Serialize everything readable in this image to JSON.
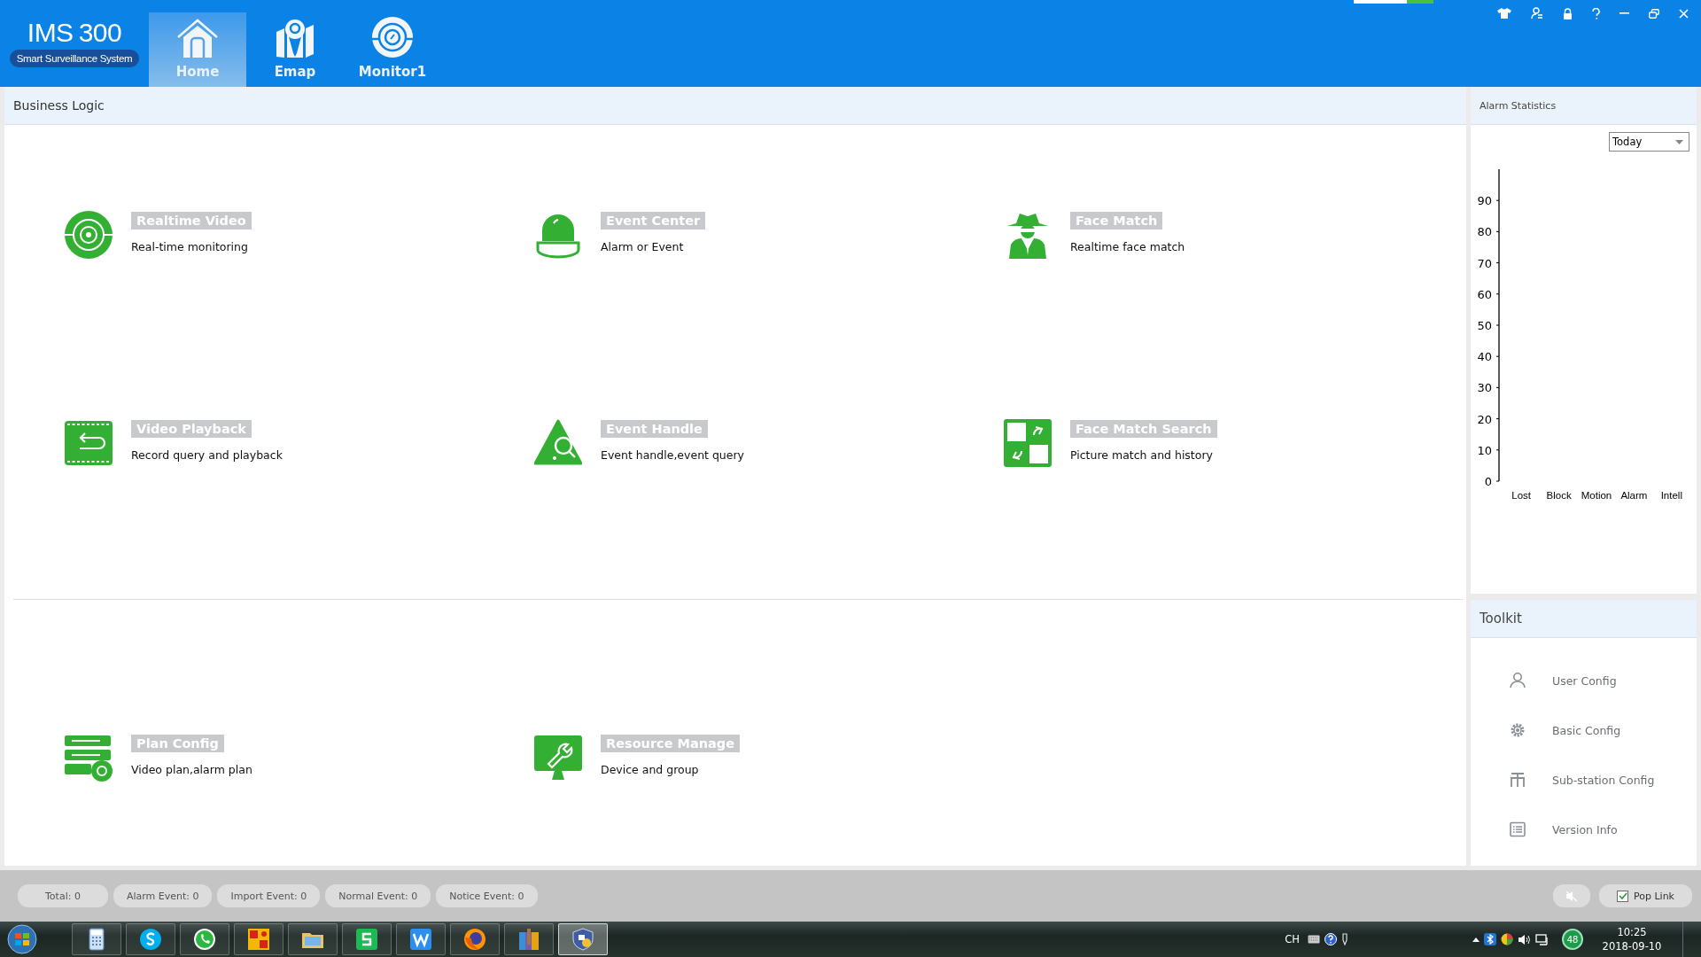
{
  "app": {
    "logo": "IMS",
    "logo_number": "300",
    "tagline": "Smart Surveillance System"
  },
  "nav_tabs": [
    {
      "kind": "home",
      "label": "Home",
      "selected": true
    },
    {
      "kind": "map",
      "label": "Emap",
      "selected": false
    },
    {
      "kind": "monitor",
      "label": "Monitor1",
      "selected": false
    }
  ],
  "business_logic": {
    "title": "Business Logic",
    "sections": [
      [
        {
          "kind": "camera",
          "title": "Realtime Video",
          "subtitle": "Real-time monitoring"
        },
        {
          "kind": "alarm-light",
          "title": "Event Center",
          "subtitle": "Alarm or Event"
        },
        {
          "kind": "spy",
          "title": "Face Match",
          "subtitle": "Realtime face match"
        },
        {
          "kind": "playback",
          "title": "Video Playback",
          "subtitle": "Record query and playback"
        },
        {
          "kind": "event-search",
          "title": "Event Handle",
          "subtitle": "Event handle,event query"
        },
        {
          "kind": "face-search",
          "title": "Face Match Search",
          "subtitle": "Picture match and history"
        }
      ],
      [
        {
          "kind": "plan",
          "title": "Plan Config",
          "subtitle": "Video plan,alarm plan"
        },
        {
          "kind": "resource",
          "title": "Resource Manage",
          "subtitle": "Device and group"
        }
      ]
    ]
  },
  "alarm_statistics": {
    "title": "Alarm Statistics",
    "period": "Today",
    "chart_data": {
      "type": "bar",
      "categories": [
        "Lost",
        "Block",
        "Motion",
        "Alarm",
        "Intell"
      ],
      "values": [
        0,
        0,
        0,
        0,
        0
      ],
      "ylim": [
        0,
        100
      ],
      "yticks": [
        0,
        10,
        20,
        30,
        40,
        50,
        60,
        70,
        80,
        90
      ]
    }
  },
  "toolkit": {
    "title": "Toolkit",
    "items": [
      {
        "kind": "user",
        "label": "User Config"
      },
      {
        "kind": "gear",
        "label": "Basic Config"
      },
      {
        "kind": "network",
        "label": "Sub-station Config"
      },
      {
        "kind": "list",
        "label": "Version Info"
      }
    ]
  },
  "status_bar": {
    "counters": [
      "Total: 0",
      "Alarm Event: 0",
      "Import Event: 0",
      "Normal Event: 0",
      "Notice Event: 0"
    ],
    "pop_link": {
      "label": "Pop Link",
      "checked": true
    }
  },
  "taskbar": {
    "apps": [
      {
        "kind": "calculator",
        "active": false
      },
      {
        "kind": "skype",
        "active": false
      },
      {
        "kind": "whatsapp",
        "active": false
      },
      {
        "kind": "orange-app",
        "active": false
      },
      {
        "kind": "folder",
        "active": false
      },
      {
        "kind": "s-app",
        "active": false
      },
      {
        "kind": "w-app",
        "active": false
      },
      {
        "kind": "firefox",
        "active": false
      },
      {
        "kind": "archive",
        "active": false
      },
      {
        "kind": "shield",
        "active": true
      }
    ],
    "input_language": "CH",
    "badge": "48",
    "time": "10:25",
    "date": "2018-09-10"
  }
}
